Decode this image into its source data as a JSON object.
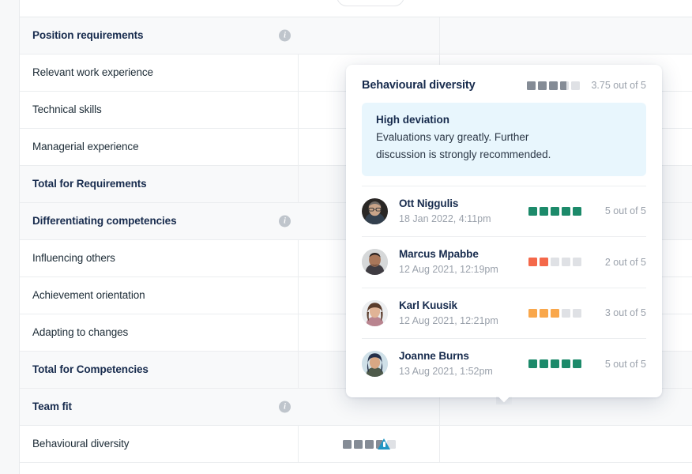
{
  "table": {
    "rows": [
      {
        "label": "Position requirements",
        "type": "section",
        "info": true
      },
      {
        "label": "Relevant work experience",
        "type": "item",
        "info": false
      },
      {
        "label": "Technical skills",
        "type": "item",
        "info": false
      },
      {
        "label": "Managerial experience",
        "type": "item",
        "info": false
      },
      {
        "label": "Total for Requirements",
        "type": "total",
        "info": false
      },
      {
        "label": "Differentiating competencies",
        "type": "section",
        "info": true
      },
      {
        "label": "Influencing others",
        "type": "item",
        "info": false
      },
      {
        "label": "Achievement orientation",
        "type": "item",
        "info": false
      },
      {
        "label": "Adapting to changes",
        "type": "item",
        "info": false
      },
      {
        "label": "Total for Competencies",
        "type": "total",
        "info": false
      },
      {
        "label": "Team fit",
        "type": "section",
        "info": true
      },
      {
        "label": "Behavioural diversity",
        "type": "item",
        "info": false,
        "rating": 3.75,
        "rating_color": "gray",
        "warning": true
      }
    ],
    "info_glyph": "i"
  },
  "popover": {
    "title": "Behavioural diversity",
    "rating": 3.75,
    "rating_color": "gray",
    "score_text": "3.75 out of 5",
    "callout": {
      "title": "High deviation",
      "text": "Evaluations vary greatly. Further discussion is strongly recommended."
    },
    "evaluations": [
      {
        "name": "Ott Niggulis",
        "date": "18 Jan 2022, 4:11pm",
        "rating": 5,
        "rating_color": "green",
        "score_text": "5 out of 5",
        "avatar": "avatar-ott-niggulis"
      },
      {
        "name": "Marcus Mpabbe",
        "date": "12 Aug 2021, 12:19pm",
        "rating": 2,
        "rating_color": "coral",
        "score_text": "2 out of 5",
        "avatar": "avatar-marcus-mpabbe"
      },
      {
        "name": "Karl Kuusik",
        "date": "12 Aug 2021, 12:21pm",
        "rating": 3,
        "rating_color": "amber",
        "score_text": "3 out of 5",
        "avatar": "avatar-karl-kuusik"
      },
      {
        "name": "Joanne Burns",
        "date": "13 Aug 2021, 1:52pm",
        "rating": 5,
        "rating_color": "green",
        "score_text": "5 out of 5",
        "avatar": "avatar-joanne-burns"
      }
    ]
  },
  "colors": {
    "green": "#1c8a6a",
    "amber": "#f9a74b",
    "coral": "#f4684a",
    "gray": "#858c96",
    "empty": "#dfe1e5",
    "callout_bg": "#e8f6fd",
    "warning": "#2196c4"
  }
}
